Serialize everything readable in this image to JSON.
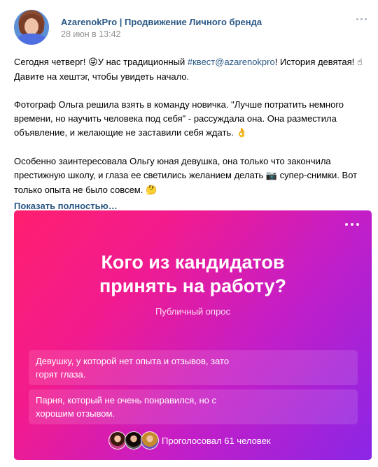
{
  "post": {
    "author": "AzarenokPro | Продвижение Личного бренда",
    "date": "28 июн в 13:42",
    "paragraph1": {
      "before_emoji": "Сегодня четверг! ",
      "emoji1": "😜",
      "mid": "У нас традиционный ",
      "hashtag": "#квест@azarenokpro",
      "after_hashtag": "! История девятая! ",
      "emoji2": "☝",
      "end": " Давите на хештэг, чтобы увидеть начало."
    },
    "paragraph2": {
      "text": "Фотограф Ольга решила взять в команду новичка. \"Лучше потратить немного времени, но научить человека под себя\" - рассуждала она. Она разместила объявление, и желающие не заставили себя ждать. ",
      "emoji": "👌"
    },
    "paragraph3": {
      "text_a": "Особенно заинтересовала Ольгу юная девушка, она только что закончила престижную школу, и глаза ее светились желанием делать ",
      "emoji_camera": "📷",
      "text_b": " супер-снимки. Вот только опыта не было совсем. ",
      "emoji_think": "🤔"
    },
    "show_more": "Показать полностью…"
  },
  "poll": {
    "title": "Кого из кандидатов принять на работу?",
    "subtitle": "Публичный опрос",
    "options": [
      {
        "label": "Девушку, у которой нет опыта и отзывов, зато горят глаза."
      },
      {
        "label": "Парня, который не очень понравился, но с хорошим отзывом."
      }
    ],
    "votes_text": "Проголосовал 61 человек"
  },
  "colors": {
    "link": "#2a5885",
    "date": "#939393",
    "poll_gradient_start": "#ff1f6f",
    "poll_gradient_end": "#8a26e6"
  },
  "icons": {
    "post_menu": "more-horizontal-icon",
    "poll_menu": "more-horizontal-icon"
  }
}
